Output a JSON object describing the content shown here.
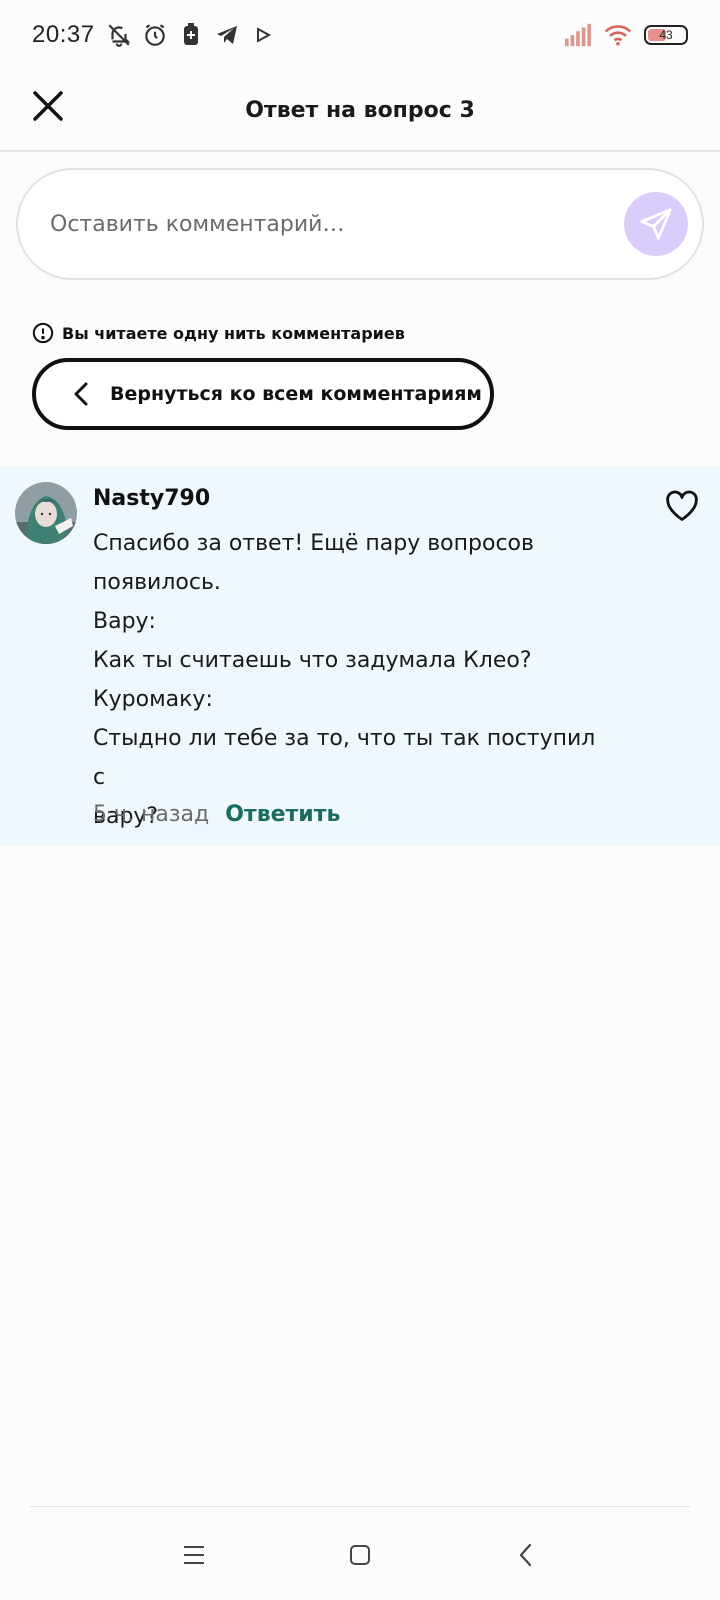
{
  "status_bar": {
    "time": "20:37",
    "battery_level": "43",
    "icons": [
      "bell-off-icon",
      "alarm-icon",
      "battery-saver-icon",
      "telegram-icon",
      "play-icon",
      "signal-icon",
      "wifi-icon",
      "battery-icon"
    ]
  },
  "header": {
    "title": "Ответ на вопрос 3"
  },
  "comment_input": {
    "placeholder": "Оставить комментарий…",
    "send_color": "#d9ccfb"
  },
  "thread_notice": {
    "text": "Вы читаете одну нить комментариев"
  },
  "back_button": {
    "label": "Вернуться ко всем комментариям"
  },
  "comment": {
    "author": "Nasty790",
    "lines": [
      "Спасибо за ответ! Ещё пару вопросов",
      "появилось.",
      "Вару:",
      "Как ты считаешь что задумала Клео?",
      "Куромаку:",
      "Стыдно ли тебе за то, что ты так поступил с",
      "вару?"
    ],
    "time_ago": "5 ч. назад",
    "reply_label": "Ответить",
    "background": "#eff9fd",
    "reply_color": "#1b6b62"
  },
  "nav": {
    "icons": [
      "menu-icon",
      "home-icon",
      "back-icon"
    ]
  }
}
